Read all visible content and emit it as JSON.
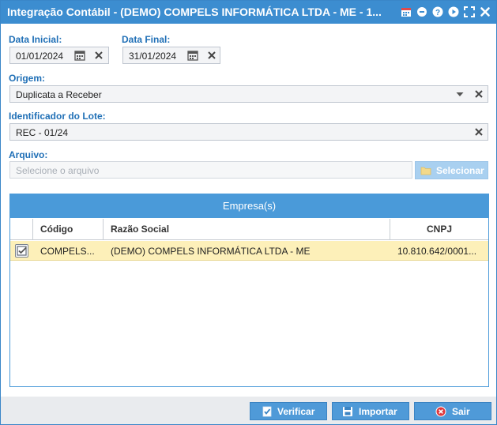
{
  "window": {
    "title": "Integração Contábil - (DEMO) COMPELS INFORMÁTICA LTDA - ME - 1..."
  },
  "titlebar_icons": [
    "calendar-icon",
    "minimize-icon",
    "help-icon",
    "play-icon",
    "maximize-icon",
    "close-icon"
  ],
  "form": {
    "data_inicial": {
      "label": "Data Inicial:",
      "value": "01/01/2024"
    },
    "data_final": {
      "label": "Data Final:",
      "value": "31/01/2024"
    },
    "origem": {
      "label": "Origem:",
      "value": "Duplicata a Receber"
    },
    "identificador": {
      "label": "Identificador do Lote:",
      "value": "REC - 01/24"
    },
    "arquivo": {
      "label": "Arquivo:",
      "placeholder": "Selecione o arquivo",
      "button": "Selecionar"
    }
  },
  "grid": {
    "title": "Empresa(s)",
    "columns": [
      "Código",
      "Razão Social",
      "CNPJ"
    ],
    "rows": [
      {
        "checked": true,
        "codigo": "COMPELS...",
        "razao_social": "(DEMO) COMPELS INFORMÁTICA LTDA - ME",
        "cnpj": "10.810.642/0001..."
      }
    ]
  },
  "footer": {
    "verificar": "Verificar",
    "importar": "Importar",
    "sair": "Sair"
  },
  "colors": {
    "accent": "#3c8dd0",
    "label": "#1f6fb6",
    "selected_row": "#fdf0b9",
    "sair_icon": "#e0393e"
  }
}
